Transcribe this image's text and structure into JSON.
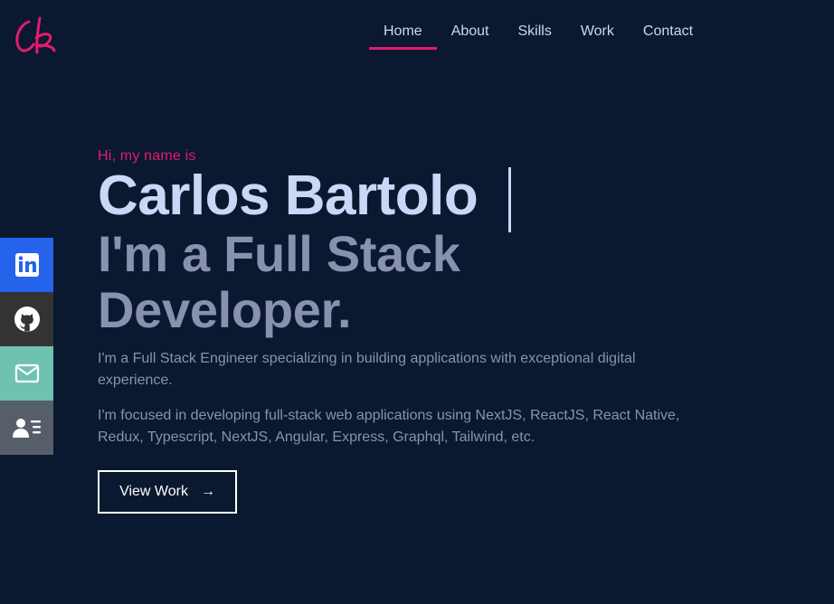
{
  "brand": {
    "logo_text": "Cb",
    "accent_color": "#e31b6d"
  },
  "nav": {
    "items": [
      {
        "label": "Home",
        "active": true
      },
      {
        "label": "About",
        "active": false
      },
      {
        "label": "Skills",
        "active": false
      },
      {
        "label": "Work",
        "active": false
      },
      {
        "label": "Contact",
        "active": false
      }
    ]
  },
  "social": [
    {
      "icon": "linkedin-icon",
      "color": "#2563eb"
    },
    {
      "icon": "github-icon",
      "color": "#333333"
    },
    {
      "icon": "mail-icon",
      "color": "#6fc2b0"
    },
    {
      "icon": "resume-icon",
      "color": "#565f69"
    }
  ],
  "hero": {
    "greeting": "Hi, my name is",
    "name": "Carlos Bartolo",
    "role_line1": "I'm a Full Stack",
    "role_line2": "Developer.",
    "description1": "I'm a Full Stack Engineer specializing in building applications with exceptional digital experience.",
    "description2": "I'm focused in developing full-stack web applications using NextJS, ReactJS, React Native, Redux, Typescript, NextJS, Angular, Express, Graphql, Tailwind, etc.",
    "cta_label": "View Work",
    "cta_arrow": "→"
  },
  "colors": {
    "background": "#0a192f",
    "heading": "#ccd6f6",
    "text": "#8892b0"
  }
}
